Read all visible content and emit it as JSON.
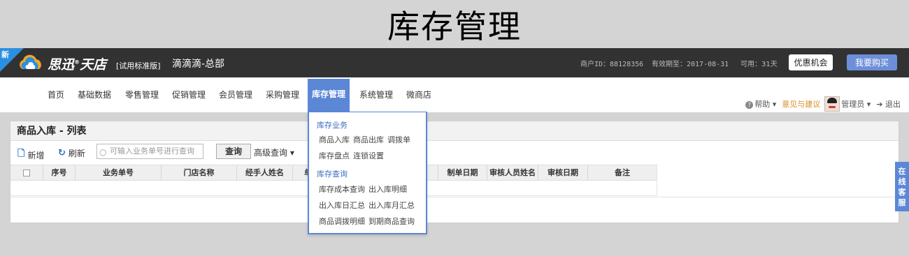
{
  "page_heading": "库存管理",
  "topbar": {
    "new_badge": "新",
    "brand": "思迅",
    "brand_reg": "®",
    "brand_sub": "天店",
    "edition": "[试用标准版]",
    "shop_name": "滴滴滴-总部",
    "merchant_id": "商户ID：88128356",
    "expire": "有效期至：2017-08-31",
    "usable": "可用：31天",
    "offer_button": "优惠机会",
    "buy_button": "我要购买",
    "colors": {
      "bar": "#323232",
      "buy": "#6d8fd9",
      "new": "#2a8fe0"
    }
  },
  "nav": {
    "items": [
      "首页",
      "基础数据",
      "零售管理",
      "促销管理",
      "会员管理",
      "采购管理",
      "库存管理",
      "系统管理",
      "微商店"
    ],
    "active": "库存管理",
    "help": "帮助",
    "feedback": "意见与建议",
    "admin": "管理员",
    "logout": "退出"
  },
  "panel": {
    "title": "商品入库 - 列表",
    "add": "新增",
    "refresh": "刷新",
    "search_placeholder": "可输入业务单号进行查询",
    "query": "查询",
    "advanced": "高级查询",
    "columns": [
      "",
      "序号",
      "业务单号",
      "门店名称",
      "经手人姓名",
      "单据",
      "",
      "制单日期",
      "审核人员姓名",
      "审核日期",
      "备注"
    ]
  },
  "dropdown": {
    "section1": "库存业务",
    "row1": [
      "商品入库",
      "商品出库",
      "调拨单"
    ],
    "row2": [
      "库存盘点",
      "连锁设置"
    ],
    "section2": "库存查询",
    "row3": [
      "库存成本查询",
      "出入库明细"
    ],
    "row4": [
      "出入库日汇总",
      "出入库月汇总"
    ],
    "row5": [
      "商品调拨明细",
      "到期商品查询"
    ]
  },
  "side_service": [
    "在",
    "线",
    "客",
    "服"
  ]
}
